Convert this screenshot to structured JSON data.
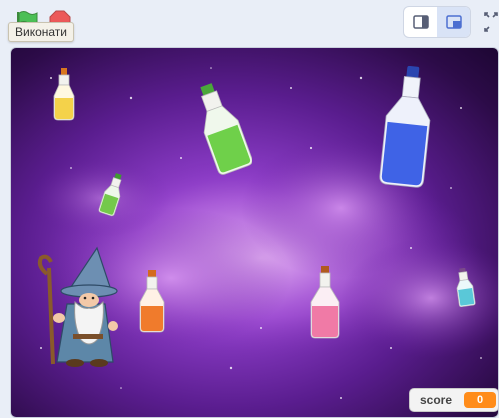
{
  "toolbar": {
    "run_tooltip": "Виконати",
    "green_flag_icon": "green-flag-icon",
    "stop_icon": "stop-sign-icon",
    "small_stage_icon": "small-stage-icon",
    "large_stage_icon": "large-stage-icon",
    "fullscreen_icon": "fullscreen-icon",
    "active_stage_mode": "small"
  },
  "stage": {
    "background": "purple smoke galaxy",
    "sprites": [
      "wizard",
      "yellow-potion",
      "green-potion",
      "small-green-potion",
      "blue-potion",
      "orange-potion",
      "pink-potion",
      "teal-potion"
    ]
  },
  "score_monitor": {
    "label": "score",
    "value": "0"
  },
  "colors": {
    "accent": "#ff8c1a",
    "toolbar_bg": "#e9eef7",
    "active_mode": "#d9e3f6"
  }
}
